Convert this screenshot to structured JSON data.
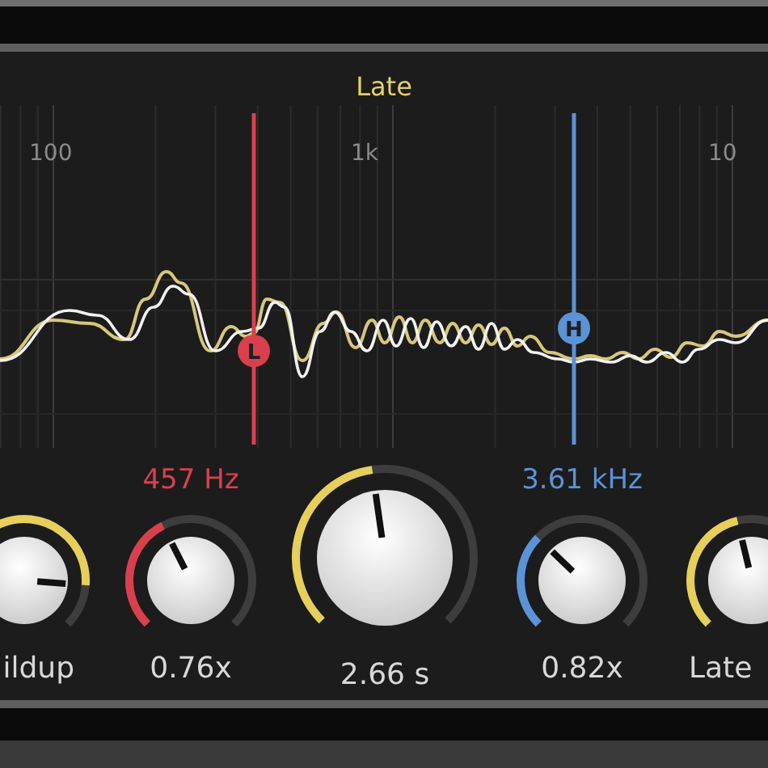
{
  "panel": {
    "title": "Late"
  },
  "graph": {
    "axis_labels": [
      "100",
      "1k",
      "10"
    ],
    "markers": [
      {
        "label": "L",
        "color": "#d9404d"
      },
      {
        "label": "H",
        "color": "#5b93d6"
      }
    ]
  },
  "knobs": [
    {
      "kind": "small",
      "color": "#e6cf5a",
      "label": "ildup"
    },
    {
      "kind": "small",
      "color": "#d9404d",
      "top_label": "457 Hz",
      "label": "0.76x"
    },
    {
      "kind": "large",
      "color": "#e6cf5a",
      "label": "2.66 s"
    },
    {
      "kind": "small",
      "color": "#5b93d6",
      "top_label": "3.61 kHz",
      "label": "0.82x"
    },
    {
      "kind": "small",
      "color": "#e6cf5a",
      "label": "Late"
    }
  ]
}
